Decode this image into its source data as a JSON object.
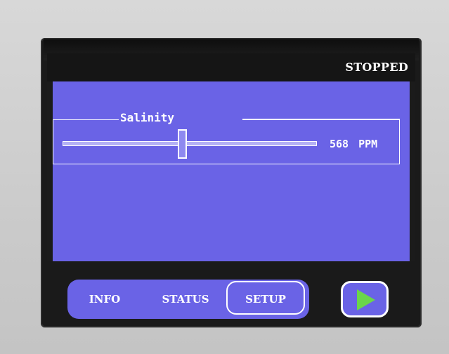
{
  "status": {
    "text": "STOPPED"
  },
  "slider": {
    "label": "Salinity",
    "value": "568",
    "unit": "PPM",
    "position_fraction": 0.47
  },
  "nav": {
    "tabs": [
      {
        "label": "INFO",
        "active": false
      },
      {
        "label": "STATUS",
        "active": false
      },
      {
        "label": "SETUP",
        "active": true
      }
    ]
  },
  "play": {
    "icon": "play-icon",
    "color": "#6ad64a"
  },
  "colors": {
    "panel": "#6a63e6",
    "track": "#b4b1f5"
  }
}
